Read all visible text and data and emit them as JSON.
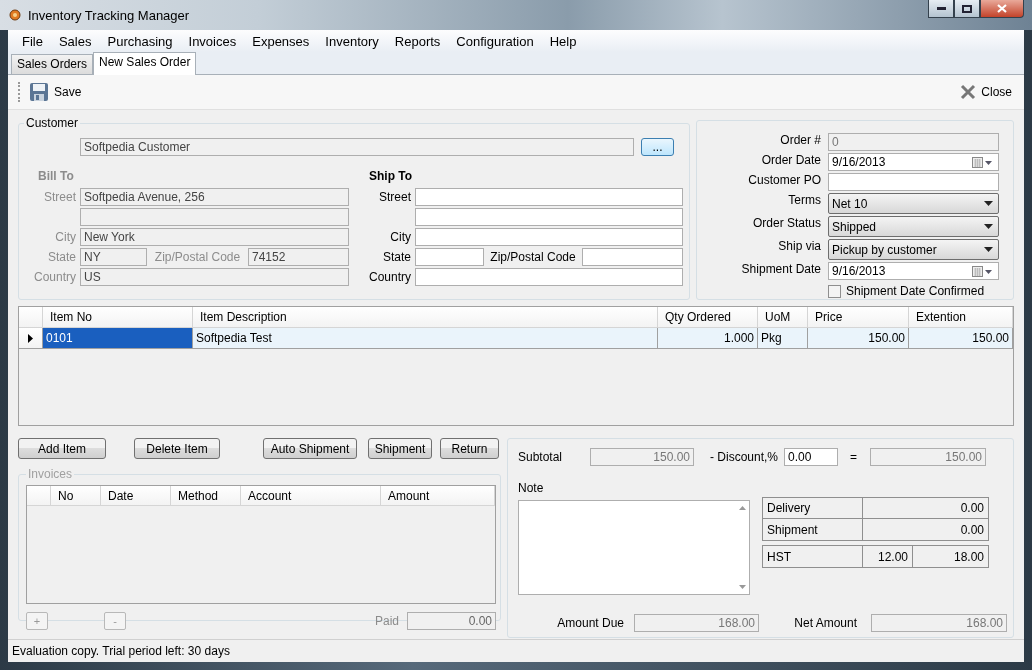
{
  "window": {
    "title": "Inventory Tracking Manager"
  },
  "menu": [
    "File",
    "Sales",
    "Purchasing",
    "Invoices",
    "Expenses",
    "Inventory",
    "Reports",
    "Configuration",
    "Help"
  ],
  "tabs": [
    {
      "label": "Sales Orders",
      "selected": false
    },
    {
      "label": "New Sales Order",
      "selected": true
    }
  ],
  "toolbar": {
    "save": "Save",
    "close": "Close"
  },
  "customer": {
    "group_label": "Customer",
    "name": "Softpedia Customer",
    "browse": "...",
    "bill_to": {
      "heading": "Bill To",
      "disabled": true,
      "street_label": "Street",
      "street": "Softpedia Avenue, 256",
      "city_label": "City",
      "city": "New York",
      "state_label": "State",
      "state": "NY",
      "zip_label": "Zip/Postal Code",
      "zip": "74152",
      "country_label": "Country",
      "country": "US"
    },
    "ship_to": {
      "heading": "Ship To",
      "disabled": false,
      "street_label": "Street",
      "city_label": "City",
      "state_label": "State",
      "zip_label": "Zip/Postal Code",
      "country_label": "Country"
    }
  },
  "order": {
    "fields": [
      {
        "kind": "text",
        "label": "Order #",
        "value": "0",
        "disabled": true
      },
      {
        "kind": "date",
        "label": "Order Date",
        "value": "9/16/2013",
        "disabled": false
      },
      {
        "kind": "text",
        "label": "Customer PO",
        "disabled": false
      },
      {
        "kind": "dropdown",
        "label": "Terms",
        "value": "Net 10",
        "disabled": false
      },
      {
        "kind": "dropdown",
        "label": "Order Status",
        "value": "Shipped",
        "disabled": false
      },
      {
        "kind": "dropdown",
        "label": "Ship via",
        "value": "Pickup by customer",
        "disabled": false
      },
      {
        "kind": "date",
        "label": "Shipment Date",
        "value": "9/16/2013",
        "disabled": false
      }
    ],
    "confirmed": {
      "label": "Shipment Date Confirmed",
      "checked": false
    }
  },
  "items": {
    "columns": [
      "Item No",
      "Item Description",
      "Qty Ordered",
      "UoM",
      "Price",
      "Extention"
    ],
    "rows": [
      {
        "cells": [
          "0101",
          "Softpedia Test",
          "1.000",
          "Pkg",
          "150.00",
          "150.00"
        ],
        "selected": true
      }
    ]
  },
  "item_buttons": [
    "Add Item",
    "Delete Item",
    "Auto Shipment",
    "Shipment",
    "Return"
  ],
  "invoices": {
    "label": "Invoices",
    "disabled": true,
    "columns": [
      "No",
      "Date",
      "Method",
      "Account",
      "Amount"
    ],
    "add": "+",
    "remove": "-",
    "paid_label": "Paid",
    "paid": "0.00"
  },
  "totals": {
    "subtotal_label": "Subtotal",
    "subtotal": "150.00",
    "discount_label": "- Discount,%",
    "discount": "0.00",
    "equals": "=",
    "discounted": "150.00",
    "note_label": "Note",
    "charges": [
      {
        "label": "Delivery",
        "value": "0.00"
      },
      {
        "label": "Shipment",
        "value": "0.00"
      }
    ],
    "tax": {
      "label": "HST",
      "rate": "12.00",
      "value": "18.00"
    },
    "amount_due_label": "Amount Due",
    "amount_due": "168.00",
    "net_label": "Net Amount",
    "net": "168.00"
  },
  "status_bar": "Evaluation copy. Trial period left: 30 days"
}
